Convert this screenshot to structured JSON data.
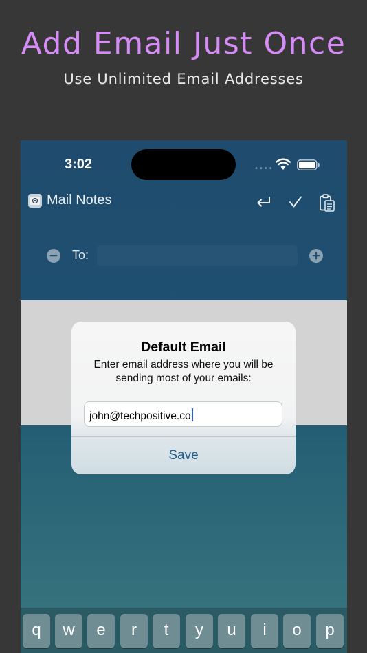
{
  "promo": {
    "headline": "Add Email Just Once",
    "subheadline": "Use Unlimited Email Addresses"
  },
  "status_bar": {
    "time": "3:02",
    "signal_dots": "••••",
    "icons": [
      "wifi-icon",
      "battery-icon"
    ]
  },
  "app": {
    "title": "Mail Notes",
    "icon": "mail-notes-app-icon",
    "toolbar_icons": [
      "return-arrow-icon",
      "checkmark-icon",
      "clipboard-icon"
    ]
  },
  "compose": {
    "to_label": "To:",
    "to_value": ""
  },
  "dialog": {
    "title": "Default Email",
    "message": "Enter email address where you will be sending most of your emails:",
    "input_value": "john@techpositive.co",
    "save_label": "Save"
  },
  "keyboard": {
    "row1": [
      "q",
      "w",
      "e",
      "r",
      "t",
      "y",
      "u",
      "i",
      "o",
      "p"
    ]
  },
  "colors": {
    "headline": "#d68cf6",
    "accent": "#215f8c",
    "background": "#373737"
  }
}
